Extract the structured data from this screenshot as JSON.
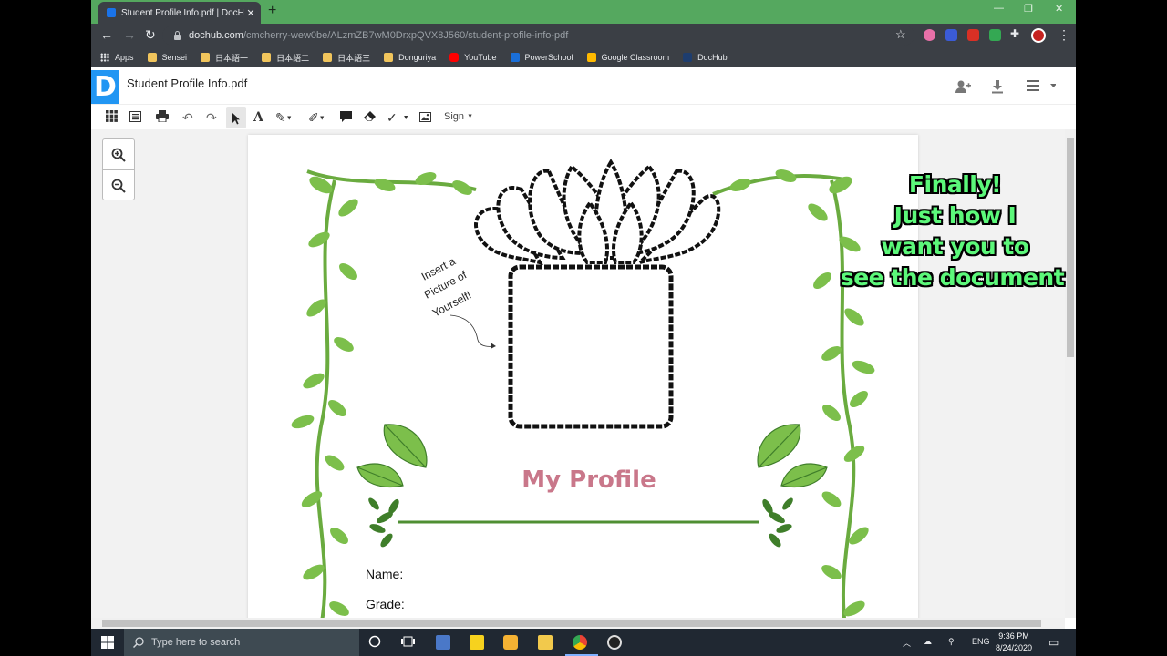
{
  "browser": {
    "tab_title": "Student Profile Info.pdf | DocHub",
    "tab_close": "✕",
    "new_tab": "+",
    "url_host": "dochub.com",
    "url_path": "/cmcherry-wew0be/ALzmZB7wM0DrxpQVX8J560/student-profile-info-pdf",
    "window_controls": [
      "—",
      "❐",
      "✕"
    ]
  },
  "bookmarks": [
    {
      "label": "Apps",
      "icon": "apps-grid-icon"
    },
    {
      "label": "Sensei",
      "icon": "folder-icon"
    },
    {
      "label": "日本語一",
      "icon": "folder-icon"
    },
    {
      "label": "日本語二",
      "icon": "folder-icon"
    },
    {
      "label": "日本語三",
      "icon": "folder-icon"
    },
    {
      "label": "Donguriya",
      "icon": "folder-icon"
    },
    {
      "label": "YouTube",
      "icon": "youtube-icon"
    },
    {
      "label": "PowerSchool",
      "icon": "powerschool-icon"
    },
    {
      "label": "Google Classroom",
      "icon": "google-classroom-icon"
    },
    {
      "label": "DocHub",
      "icon": "dochub-icon"
    }
  ],
  "dochub": {
    "logo": "D",
    "doc_title": "Student Profile Info.pdf",
    "sign_label": "Sign"
  },
  "document": {
    "photo_prompt": [
      "Insert a",
      "Picture of",
      "Yourself!"
    ],
    "heading": "My Profile",
    "fields": [
      "Name:",
      "Grade:"
    ]
  },
  "overlay": {
    "lines": [
      "Finally!",
      "Just how I",
      "want you to",
      "see the document"
    ]
  },
  "taskbar": {
    "search_placeholder": "Type here to search",
    "language": "ENG",
    "time": "9:36 PM",
    "date": "8/24/2020"
  },
  "colors": {
    "tab_strip": "#55a85f",
    "chrome_dark": "#3b3f45",
    "dochub_blue": "#2196f3",
    "heading_pink": "#c9778a",
    "vine_green": "#6aab3f",
    "overlay_green": "#5cf87a"
  }
}
